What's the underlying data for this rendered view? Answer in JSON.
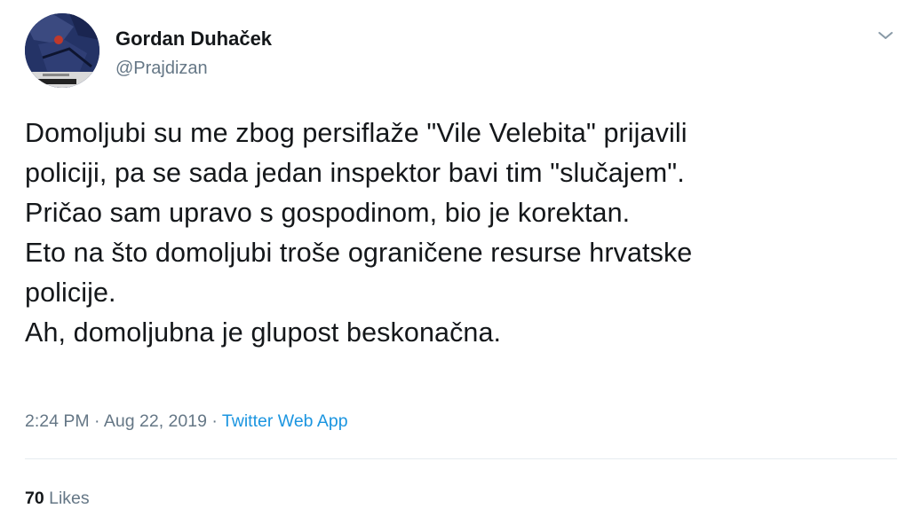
{
  "user": {
    "display_name": "Gordan Duhaček",
    "handle": "@Prajdizan",
    "avatar_icon": "profile-avatar"
  },
  "menu": {
    "icon": "chevron-down-icon"
  },
  "tweet": {
    "text": "Domoljubi su me zbog persiflaže \"Vile Velebita\" prijavili\npoliciji, pa se sada jedan inspektor bavi tim \"slučajem\".\nPričao sam upravo s gospodinom, bio je korektan.\nEto na što domoljubi troše ograničene resurse hrvatske\npolicije.\nAh, domoljubna je glupost beskonačna.",
    "time": "2:24 PM",
    "separator": "·",
    "date": "Aug 22, 2019",
    "source": "Twitter Web App"
  },
  "stats": {
    "likes_count": "70",
    "likes_label": "Likes"
  },
  "colors": {
    "text": "#14171a",
    "secondary": "#657786",
    "link": "#1b95e0",
    "divider": "#e6ecf0"
  }
}
